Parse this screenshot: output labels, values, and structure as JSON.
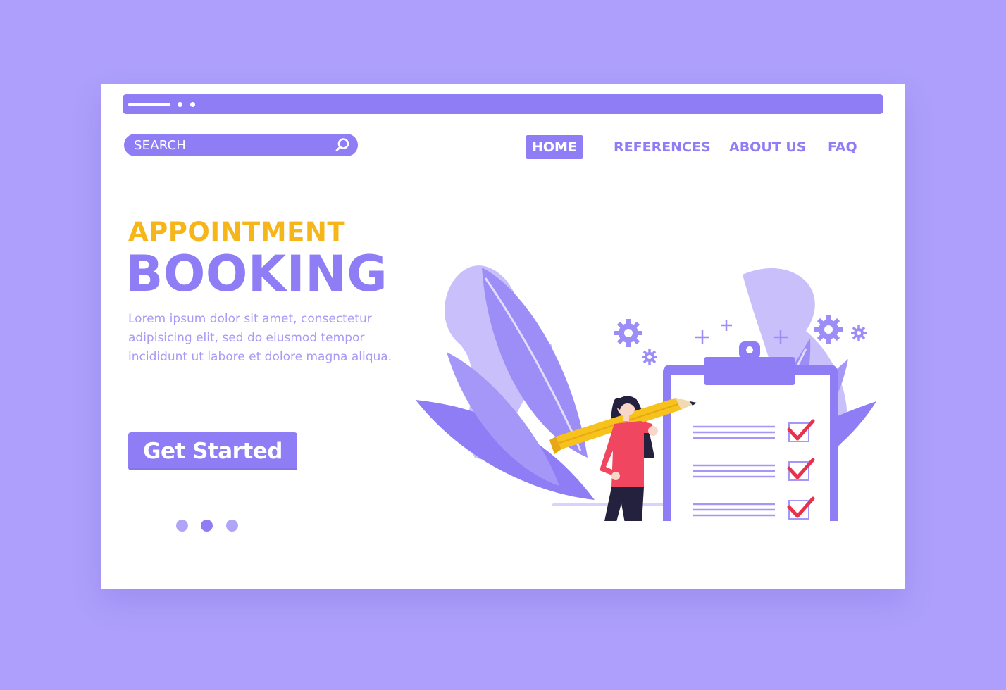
{
  "browser": {
    "chrome_icon": "window-controls"
  },
  "search": {
    "label": "SEARCH",
    "icon": "search-icon"
  },
  "nav": {
    "items": [
      {
        "label": "HOME",
        "active": true
      },
      {
        "label": "REFERENCES",
        "active": false
      },
      {
        "label": "ABOUT US",
        "active": false
      },
      {
        "label": "FAQ",
        "active": false
      }
    ]
  },
  "hero": {
    "kicker": "APPOINTMENT",
    "title": "BOOKING",
    "description": "Lorem ipsum dolor sit amet, consectetur adipisicing elit, sed do eiusmod tempor incididunt ut labore et dolore magna aliqua.",
    "cta_label": "Get Started"
  },
  "pager": {
    "count": 3,
    "active_index": 1
  },
  "colors": {
    "background": "#ad9ffb",
    "accent": "#8f7df5",
    "kicker": "#f6b519",
    "check": "#e8324b",
    "shirt": "#f0465f"
  }
}
